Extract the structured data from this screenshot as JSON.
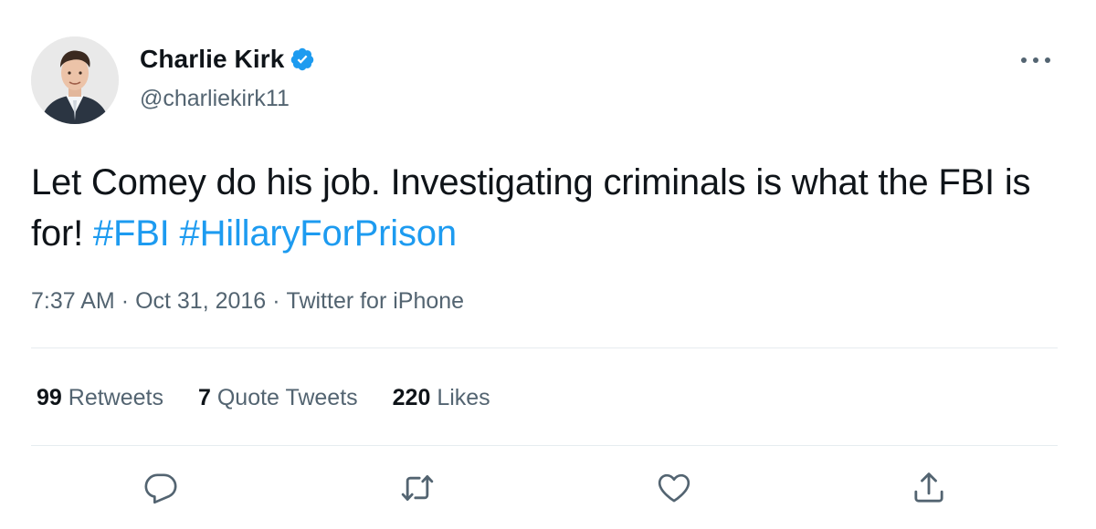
{
  "author": {
    "display_name": "Charlie Kirk",
    "handle": "@charliekirk11",
    "verified": true,
    "avatar": "profile-photo"
  },
  "tweet": {
    "text_before": "Let Comey do his job. Investigating criminals is what the FBI is for! ",
    "hashtags": [
      "#FBI",
      "#HillaryForPrison"
    ]
  },
  "meta": {
    "time": "7:37 AM",
    "separator": "·",
    "date": "Oct 31, 2016",
    "source": "Twitter for iPhone"
  },
  "stats": {
    "retweets_count": "99",
    "retweets_label": "Retweets",
    "quotes_count": "7",
    "quotes_label": "Quote Tweets",
    "likes_count": "220",
    "likes_label": "Likes"
  },
  "actions": {
    "reply": "reply-icon",
    "retweet": "retweet-icon",
    "like": "heart-icon",
    "share": "share-icon",
    "more": "more-icon"
  },
  "colors": {
    "text": "#0f1419",
    "secondary": "#536471",
    "accent": "#1d9bf0",
    "divider": "#e6ecf0"
  }
}
